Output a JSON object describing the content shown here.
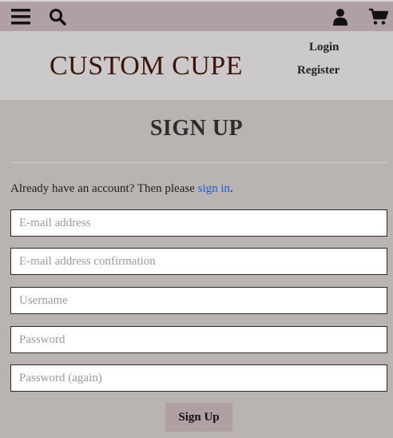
{
  "topbar": {
    "icons": [
      "menu-icon",
      "search-icon",
      "user-icon",
      "cart-icon"
    ],
    "background": "#b09fa3"
  },
  "header": {
    "brand": "CUSTOM CUPE",
    "login_label": "Login",
    "register_label": "Register",
    "brand_color": "#3a1508"
  },
  "main": {
    "title": "SIGN UP",
    "lead_text": "Already have an account? Then please ",
    "lead_link": "sign in",
    "lead_end": ".",
    "link_color": "#1a5fd6",
    "fields": [
      {
        "placeholder": "E-mail address",
        "value": ""
      },
      {
        "placeholder": "E-mail address confirmation",
        "value": ""
      },
      {
        "placeholder": "Username",
        "value": ""
      },
      {
        "placeholder": "Password",
        "value": ""
      },
      {
        "placeholder": "Password (again)",
        "value": ""
      }
    ],
    "submit_label": "Sign Up"
  }
}
